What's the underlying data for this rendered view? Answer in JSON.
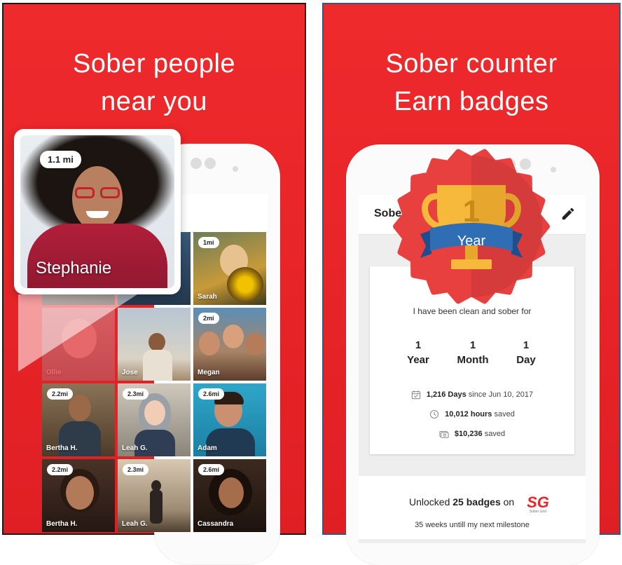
{
  "left_panel": {
    "headline_line1": "Sober people",
    "headline_line2": "near you",
    "featured": {
      "distance": "1.1 mi",
      "name": "Stephanie"
    },
    "tiles": [
      {
        "distance": "1mi",
        "name": "Sarah"
      },
      {
        "distance": "",
        "name": "Ollie"
      },
      {
        "distance": "",
        "name": "Jose"
      },
      {
        "distance": "2mi",
        "name": "Megan"
      },
      {
        "distance": "2.2mi",
        "name": "Bertha H."
      },
      {
        "distance": "2.3mi",
        "name": "Leah G."
      },
      {
        "distance": "2.6mi",
        "name": "Adam"
      },
      {
        "distance": "2.2mi",
        "name": "Bertha H."
      },
      {
        "distance": "2.3mi",
        "name": "Leah G."
      },
      {
        "distance": "2.6mi",
        "name": "Cassandra"
      }
    ]
  },
  "right_panel": {
    "headline_line1": "Sober counter",
    "headline_line2": "Earn badges",
    "app_bar_title": "Sobe",
    "badge": {
      "number": "1",
      "label": "Year"
    },
    "counter": {
      "intro": "I have been clean and sober for",
      "units": [
        {
          "value": "1",
          "label": "Year"
        },
        {
          "value": "1",
          "label": "Month"
        },
        {
          "value": "1",
          "label": "Day"
        }
      ],
      "days_bold": "1,216 Days",
      "days_rest": " since Jun 10, 2017",
      "hours_bold": "10,012 hours",
      "hours_rest": " saved",
      "money_bold": "$10,236",
      "money_rest": " saved"
    },
    "badges": {
      "prefix": "Unlocked ",
      "count": "25 badges",
      "suffix": " on",
      "logo_text": "SG",
      "logo_sub": "Sober Grid",
      "milestone": "35 weeks untill my next milestone"
    }
  },
  "colors": {
    "brand_red": "#e8262a",
    "seal_red": "#e8403f",
    "trophy_gold": "#f6b93b",
    "ribbon_blue": "#2f6db5"
  }
}
